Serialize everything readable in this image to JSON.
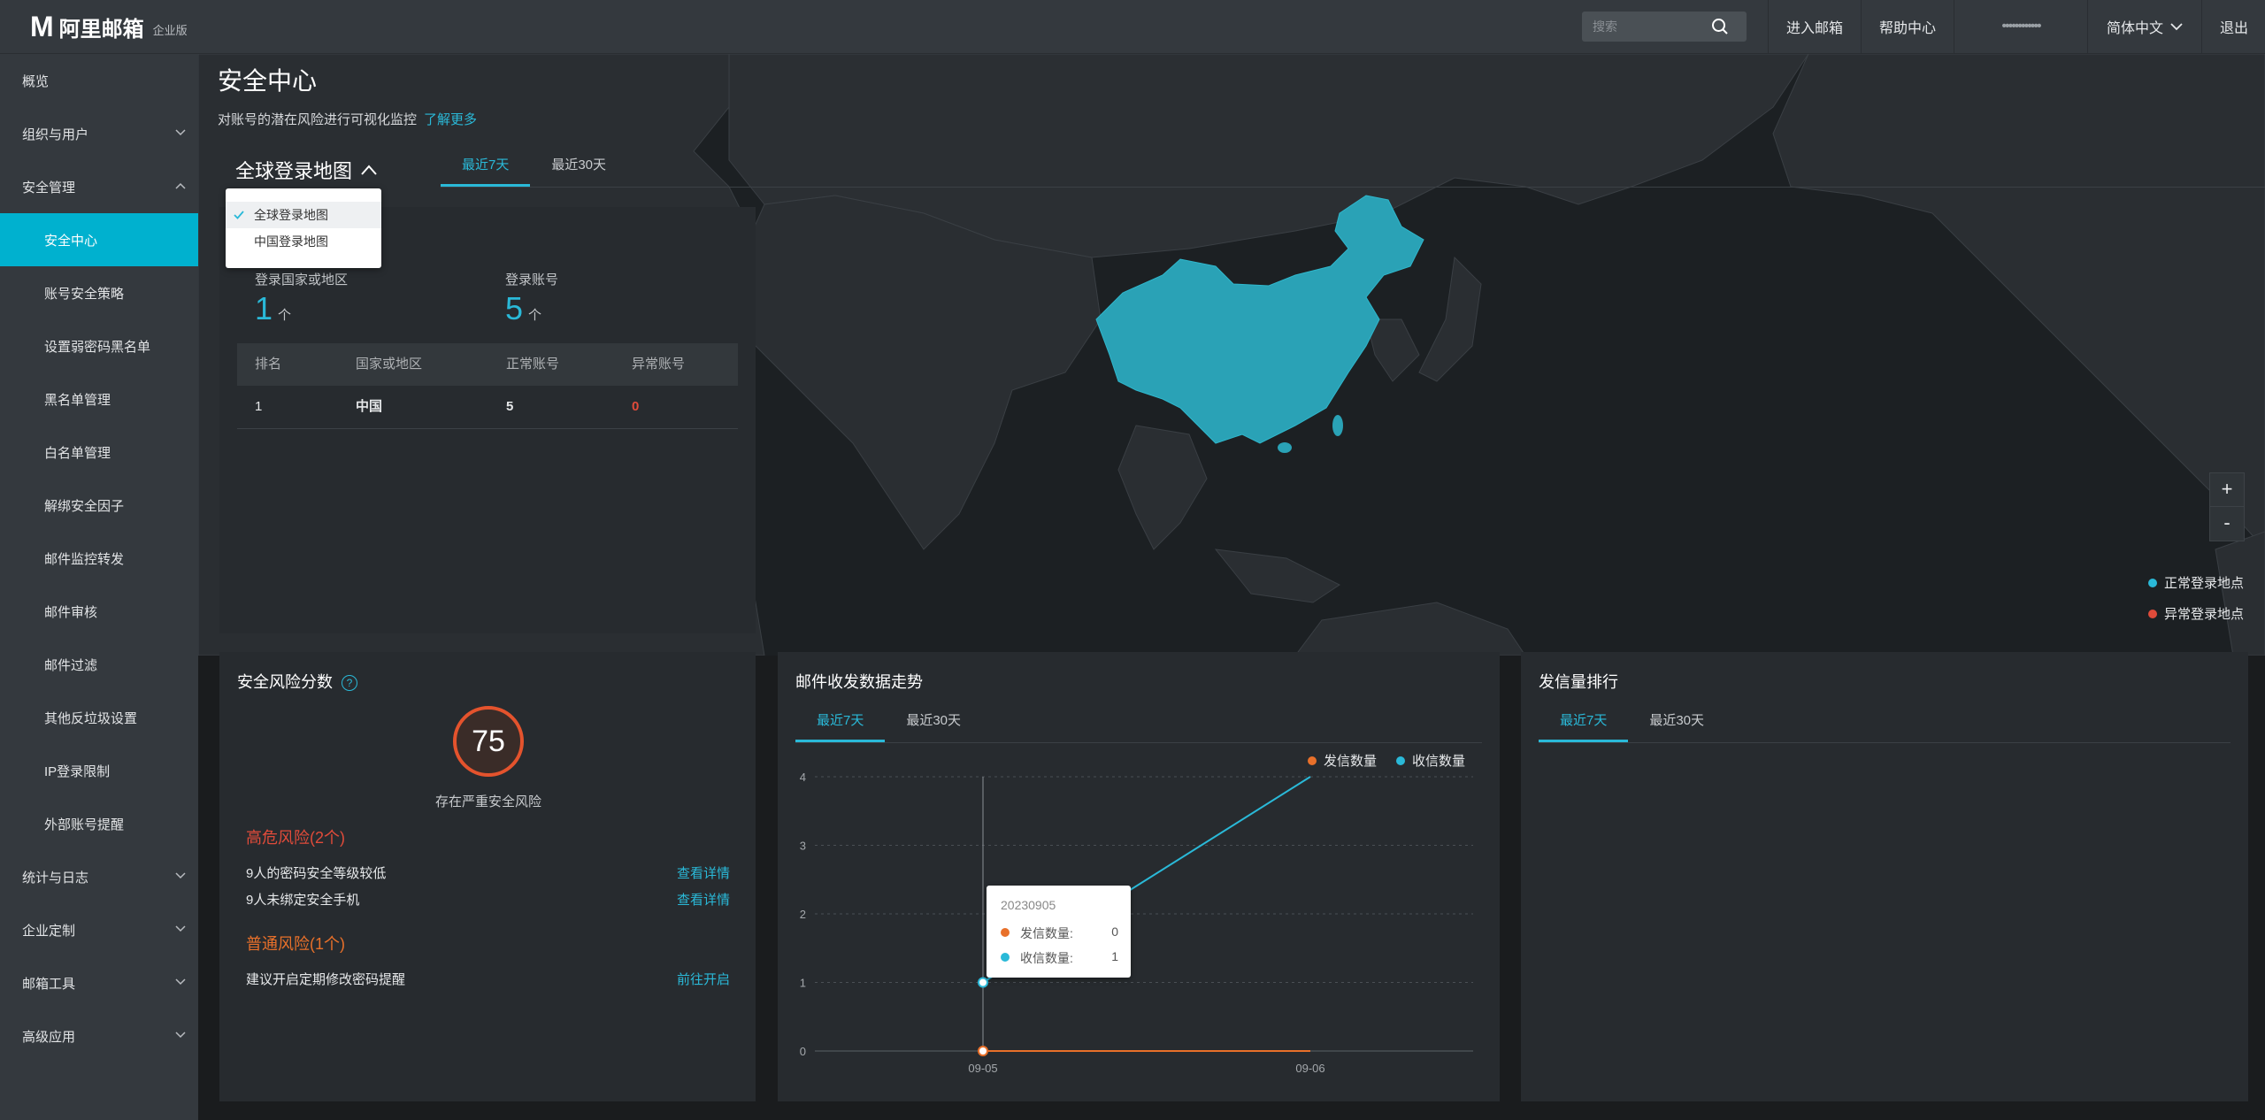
{
  "app": {
    "logo_mark": "M",
    "logo_text": "阿里邮箱",
    "edition": "企业版"
  },
  "topbar": {
    "search_placeholder": "搜索",
    "enter_mail": "进入邮箱",
    "help_center": "帮助中心",
    "account": "••••••••••••",
    "language": "简体中文",
    "logout": "退出"
  },
  "sidebar": {
    "items": [
      {
        "label": "概览"
      },
      {
        "label": "组织与用户"
      },
      {
        "label": "安全管理"
      },
      {
        "label": "安全中心"
      },
      {
        "label": "账号安全策略"
      },
      {
        "label": "设置弱密码黑名单"
      },
      {
        "label": "黑名单管理"
      },
      {
        "label": "白名单管理"
      },
      {
        "label": "解绑安全因子"
      },
      {
        "label": "邮件监控转发"
      },
      {
        "label": "邮件审核"
      },
      {
        "label": "邮件过滤"
      },
      {
        "label": "其他反垃圾设置"
      },
      {
        "label": "IP登录限制"
      },
      {
        "label": "外部账号提醒"
      },
      {
        "label": "统计与日志"
      },
      {
        "label": "企业定制"
      },
      {
        "label": "邮箱工具"
      },
      {
        "label": "高级应用"
      }
    ]
  },
  "page": {
    "title": "安全中心",
    "subtitle": "对账号的潜在风险进行可视化监控",
    "learn_more": "了解更多"
  },
  "map": {
    "selector_label": "全球登录地图",
    "tabs": [
      "最近7天",
      "最近30天"
    ],
    "dropdown": [
      "全球登录地图",
      "中国登录地图"
    ],
    "zoom_in": "+",
    "zoom_out": "-",
    "legend_normal": "正常登录地点",
    "legend_abnormal": "异常登录地点",
    "colors": {
      "normal": "#2ab9d8",
      "abnormal": "#e04b3a",
      "china_fill": "#2aa2b6"
    }
  },
  "login_stats": {
    "region_label": "登录国家或地区",
    "region_value": "1",
    "region_unit": "个",
    "account_label": "登录账号",
    "account_value": "5",
    "account_unit": "个",
    "table": {
      "headers": [
        "排名",
        "国家或地区",
        "正常账号",
        "异常账号"
      ],
      "rows": [
        [
          "1",
          "中国",
          "5",
          "0"
        ]
      ]
    }
  },
  "risk": {
    "title": "安全风险分数",
    "help": "?",
    "score": "75",
    "caption": "存在严重安全风险",
    "high_title": "高危风险(2个)",
    "high_items": [
      {
        "text": "9人的密码安全等级较低",
        "action": "查看详情"
      },
      {
        "text": "9人未绑定安全手机",
        "action": "查看详情"
      }
    ],
    "normal_title": "普通风险(1个)",
    "normal_items": [
      {
        "text": "建议开启定期修改密码提醒",
        "action": "前往开启"
      }
    ]
  },
  "trend": {
    "title": "邮件收发数据走势",
    "tabs": [
      "最近7天",
      "最近30天"
    ],
    "tooltip": {
      "date": "20230905",
      "sent_label": "发信数量:",
      "sent_value": "0",
      "recv_label": "收信数量:",
      "recv_value": "1"
    }
  },
  "ranking": {
    "title": "发信量排行",
    "tabs": [
      "最近7天",
      "最近30天"
    ]
  },
  "chart_data": {
    "type": "line",
    "x": [
      "09-05",
      "09-06"
    ],
    "ylim": [
      0,
      4
    ],
    "yticks": [
      "0",
      "1",
      "2",
      "3",
      "4"
    ],
    "grid": true,
    "legend_position": "top-right",
    "series": [
      {
        "name": "发信数量",
        "color": "#e8702a",
        "values": [
          0,
          0
        ]
      },
      {
        "name": "收信数量",
        "color": "#2ab9d8",
        "values": [
          1,
          4
        ]
      }
    ]
  }
}
